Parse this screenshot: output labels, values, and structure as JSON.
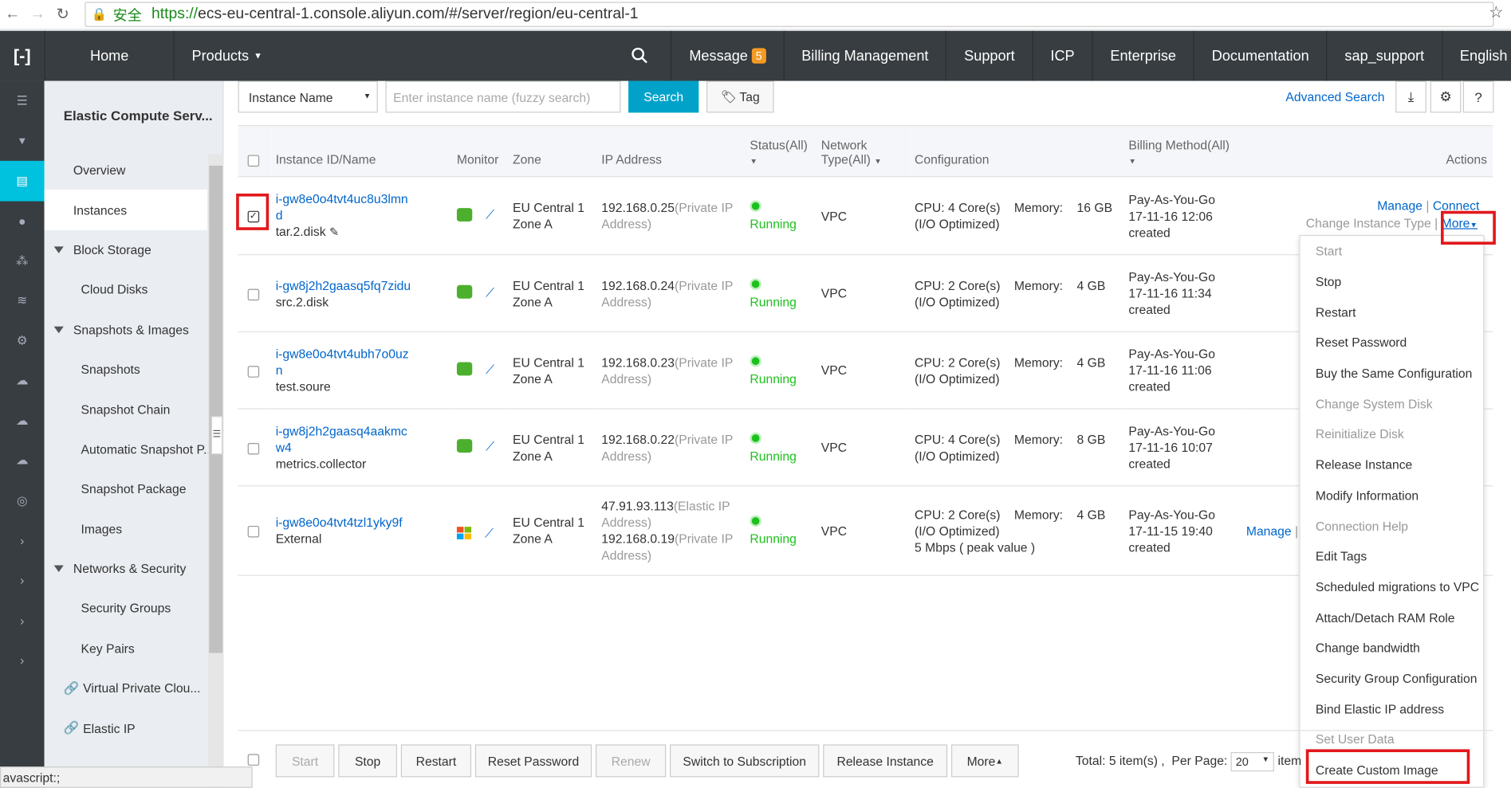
{
  "browser": {
    "secure_label": "安全",
    "url_scheme": "https://",
    "url_rest": "ecs-eu-central-1.console.aliyun.com/#/server/region/eu-central-1",
    "status_text": "avascript:;"
  },
  "topnav": {
    "home": "Home",
    "products": "Products",
    "message": "Message",
    "message_count": "5",
    "billing": "Billing Management",
    "support": "Support",
    "icp": "ICP",
    "enterprise": "Enterprise",
    "documentation": "Documentation",
    "account": "sap_support",
    "language": "English"
  },
  "sidebar": {
    "title": "Elastic Compute Serv...",
    "items": [
      {
        "label": "Overview"
      },
      {
        "label": "Instances"
      },
      {
        "label": "Block Storage"
      },
      {
        "label": "Cloud Disks"
      },
      {
        "label": "Snapshots & Images"
      },
      {
        "label": "Snapshots"
      },
      {
        "label": "Snapshot Chain"
      },
      {
        "label": "Automatic Snapshot P..."
      },
      {
        "label": "Snapshot Package"
      },
      {
        "label": "Images"
      },
      {
        "label": "Networks & Security"
      },
      {
        "label": "Security Groups"
      },
      {
        "label": "Key Pairs"
      },
      {
        "label": "Virtual Private Clou..."
      },
      {
        "label": "Elastic IP"
      }
    ]
  },
  "search": {
    "filter_selected": "Instance Name",
    "placeholder": "Enter instance name (fuzzy search)",
    "search_label": "Search",
    "tag_label": "Tag",
    "advanced_label": "Advanced Search"
  },
  "table": {
    "headers": {
      "instance": "Instance ID/Name",
      "monitor": "Monitor",
      "zone": "Zone",
      "ip": "IP Address",
      "status": "Status(All)",
      "network": "Network Type(All)",
      "config": "Configuration",
      "billing": "Billing Method(All)",
      "actions": "Actions"
    },
    "rows": [
      {
        "id": "i-gw8e0o4tvt4uc8u3lmnd",
        "name": "tar.2.disk",
        "zone1": "EU Central 1",
        "zone2": "Zone A",
        "ip1": "192.168.0.25",
        "ip1_type": "(Private IP",
        "ip1_type2": "Address)",
        "status": "Running",
        "network": "VPC",
        "cpu": "CPU: 4 Core(s)",
        "memory_label": "Memory:",
        "memory": "16 GB",
        "io": "(I/O Optimized)",
        "billing1": "Pay-As-You-Go",
        "billing2": "17-11-16 12:06",
        "billing3": "created"
      },
      {
        "id": "i-gw8j2h2gaasq5fq7zidu",
        "name": "src.2.disk",
        "zone1": "EU Central 1",
        "zone2": "Zone A",
        "ip1": "192.168.0.24",
        "ip1_type": "(Private IP",
        "ip1_type2": "Address)",
        "status": "Running",
        "network": "VPC",
        "cpu": "CPU: 2 Core(s)",
        "memory_label": "Memory:",
        "memory": "4 GB",
        "io": "(I/O Optimized)",
        "billing1": "Pay-As-You-Go",
        "billing2": "17-11-16 11:34",
        "billing3": "created"
      },
      {
        "id": "i-gw8e0o4tvt4ubh7o0uzn",
        "name": "test.soure",
        "zone1": "EU Central 1",
        "zone2": "Zone A",
        "ip1": "192.168.0.23",
        "ip1_type": "(Private IP",
        "ip1_type2": "Address)",
        "status": "Running",
        "network": "VPC",
        "cpu": "CPU: 2 Core(s)",
        "memory_label": "Memory:",
        "memory": "4 GB",
        "io": "(I/O Optimized)",
        "billing1": "Pay-As-You-Go",
        "billing2": "17-11-16 11:06",
        "billing3": "created"
      },
      {
        "id": "i-gw8j2h2gaasq4aakmcw4",
        "name": "metrics.collector",
        "zone1": "EU Central 1",
        "zone2": "Zone A",
        "ip1": "192.168.0.22",
        "ip1_type": "(Private IP",
        "ip1_type2": "Address)",
        "status": "Running",
        "network": "VPC",
        "cpu": "CPU: 4 Core(s)",
        "memory_label": "Memory:",
        "memory": "8 GB",
        "io": "(I/O Optimized)",
        "billing1": "Pay-As-You-Go",
        "billing2": "17-11-16 10:07",
        "billing3": "created"
      },
      {
        "id": "i-gw8e0o4tvt4tzl1yky9f",
        "name": "External",
        "zone1": "EU Central 1",
        "zone2": "Zone A",
        "ip1": "47.91.93.113",
        "ip1_type": "(Elastic IP",
        "ip1_type2": "Address)",
        "ip2": "192.168.0.19",
        "ip2_type": "(Private IP",
        "ip2_type2": "Address)",
        "status": "Running",
        "network": "VPC",
        "cpu": "CPU: 2 Core(s)",
        "memory_label": "Memory:",
        "memory": "4 GB",
        "io": "(I/O Optimized)",
        "bandwidth": "5 Mbps ( peak value )",
        "billing1": "Pay-As-You-Go",
        "billing2": "17-11-15 19:40",
        "billing3": "created",
        "manage": "Manage"
      }
    ],
    "row1_actions": {
      "manage": "Manage",
      "connect": "Connect",
      "change_type": "Change Instance Type",
      "more": "More"
    }
  },
  "dropdown": {
    "items": [
      {
        "label": "Start",
        "disabled": true
      },
      {
        "label": "Stop"
      },
      {
        "label": "Restart"
      },
      {
        "label": "Reset Password"
      },
      {
        "label": "Buy the Same Configuration"
      },
      {
        "label": "Change System Disk",
        "disabled": true
      },
      {
        "label": "Reinitialize Disk",
        "disabled": true
      },
      {
        "label": "Release Instance"
      },
      {
        "label": "Modify Information"
      },
      {
        "label": "Connection Help",
        "disabled": true
      },
      {
        "label": "Edit Tags"
      },
      {
        "label": "Scheduled migrations to VPC"
      },
      {
        "label": "Attach/Detach RAM Role"
      },
      {
        "label": "Change bandwidth"
      },
      {
        "label": "Security Group Configuration"
      },
      {
        "label": "Bind Elastic IP address"
      },
      {
        "label": "Set User Data",
        "disabled": true
      },
      {
        "label": "Create Custom Image"
      }
    ]
  },
  "bottombar": {
    "start": "Start",
    "stop": "Stop",
    "restart": "Restart",
    "reset_password": "Reset Password",
    "renew": "Renew",
    "switch": "Switch to Subscription",
    "release": "Release Instance",
    "more": "More",
    "total": "Total: 5 item(s) ,",
    "per_page_label": "Per Page:",
    "per_page": "20",
    "items_suffix": "item"
  }
}
